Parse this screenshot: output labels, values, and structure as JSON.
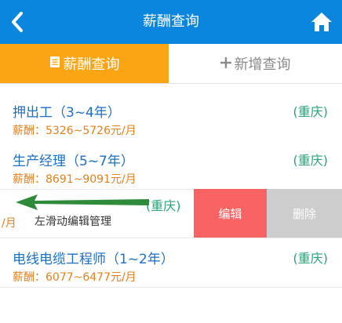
{
  "header": {
    "title": "薪酬查询",
    "back_icon": "chevron-left-icon",
    "home_icon": "home-icon",
    "bg_color": "#0b86de"
  },
  "tabs": [
    {
      "label": "薪酬查询",
      "icon": "document-icon",
      "active": true
    },
    {
      "label": "新增查询",
      "icon": "plus-icon",
      "active": false
    }
  ],
  "jobs": [
    {
      "title": "押出工（3~4年）",
      "city": "(重庆)",
      "salary": "薪酬：5326~5726元/月"
    },
    {
      "title": "生产经理（5~7年）",
      "city": "(重庆)",
      "salary": "薪酬：8691~9091元/月"
    },
    {
      "title": "电线电缆工程师（1~2年）",
      "city": "(重庆)",
      "salary": "薪酬：6077~6477元/月"
    }
  ],
  "swipe_row": {
    "salary_tail": "/月",
    "city": "(重庆)",
    "edit_label": "编辑",
    "delete_label": "删除",
    "hint": "左滑动编辑管理"
  },
  "colors": {
    "active_tab": "#fca514",
    "edit": "#fa6363",
    "delete": "#cdcdcd",
    "title_text": "#1b6fc4",
    "salary_text": "#e3801b",
    "city_text": "#2aa37a",
    "arrow": "#2e8b3a"
  }
}
